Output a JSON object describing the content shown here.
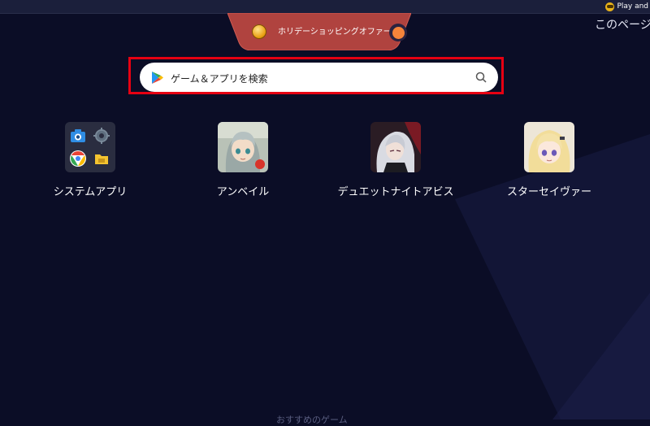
{
  "topbar": {
    "label": "Play and"
  },
  "promo": {
    "text": "ホリデーショッピングオファー"
  },
  "page_link": "このページ",
  "search": {
    "placeholder": "ゲーム＆アプリを検索"
  },
  "apps": [
    {
      "label": "システムアプリ"
    },
    {
      "label": "アンベイル"
    },
    {
      "label": "デュエットナイトアビス"
    },
    {
      "label": "スターセイヴァー"
    }
  ],
  "bottom_text": "おすすめのゲーム",
  "colors": {
    "background": "#0b0d26",
    "promo": "#b0433f",
    "highlight": "#e60012",
    "toggle": "#f5843a"
  }
}
